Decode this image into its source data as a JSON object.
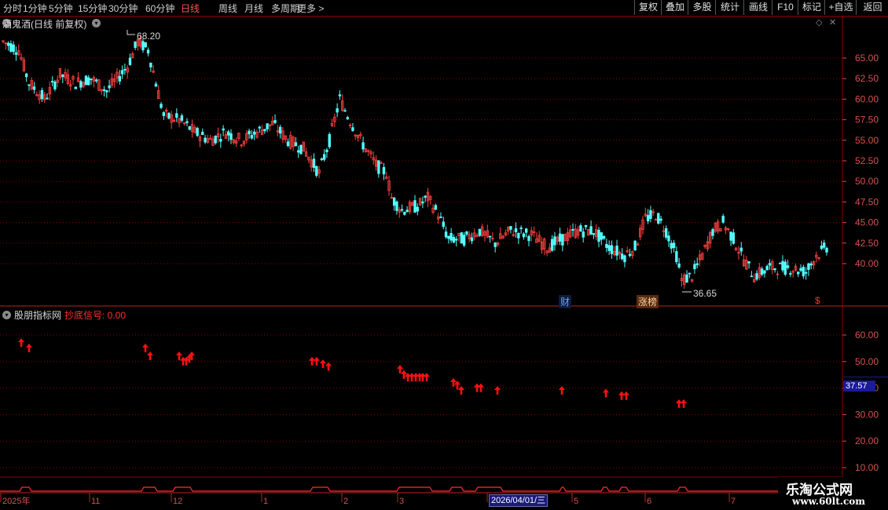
{
  "toolbar": {
    "periods": [
      "分时",
      "1分钟",
      "5分钟",
      "15分钟",
      "30分钟",
      "60分钟",
      "日线",
      "周线",
      "月线",
      "多周期",
      "更多 >"
    ],
    "active_period": "日线",
    "buttons": [
      "复权",
      "叠加",
      "多股",
      "统计",
      "画线",
      "F10",
      "标记",
      "+自选",
      "返回"
    ]
  },
  "main_chart": {
    "title": "酒鬼酒(日线 前复权)",
    "high_marker": "68.20",
    "low_marker": "36.65",
    "y_ticks": [
      "65.00",
      "62.50",
      "60.00",
      "57.50",
      "55.00",
      "52.50",
      "50.00",
      "47.50",
      "45.00",
      "42.50",
      "40.00"
    ],
    "event_tags": [
      "财",
      "涨榜",
      "$"
    ]
  },
  "indicator": {
    "title": "股朋指标网",
    "signal_label": "抄底信号: 0.00",
    "y_ticks": [
      "60.00",
      "50.00",
      "40.00",
      "30.00",
      "20.00",
      "10.00"
    ],
    "cursor_value": "37.57"
  },
  "date_axis": {
    "labels": [
      "2025年",
      "11",
      "12",
      "1",
      "2",
      "3",
      "4",
      "5",
      "6",
      "7"
    ],
    "cursor_date": "2026/04/01/三"
  },
  "watermark": {
    "line1": "乐淘公式网",
    "line2": "www.60lt.com"
  },
  "colors": {
    "up": "#ff4040",
    "down": "#54ffff",
    "grid": "#8b0000",
    "signal": "#ff1010"
  }
}
